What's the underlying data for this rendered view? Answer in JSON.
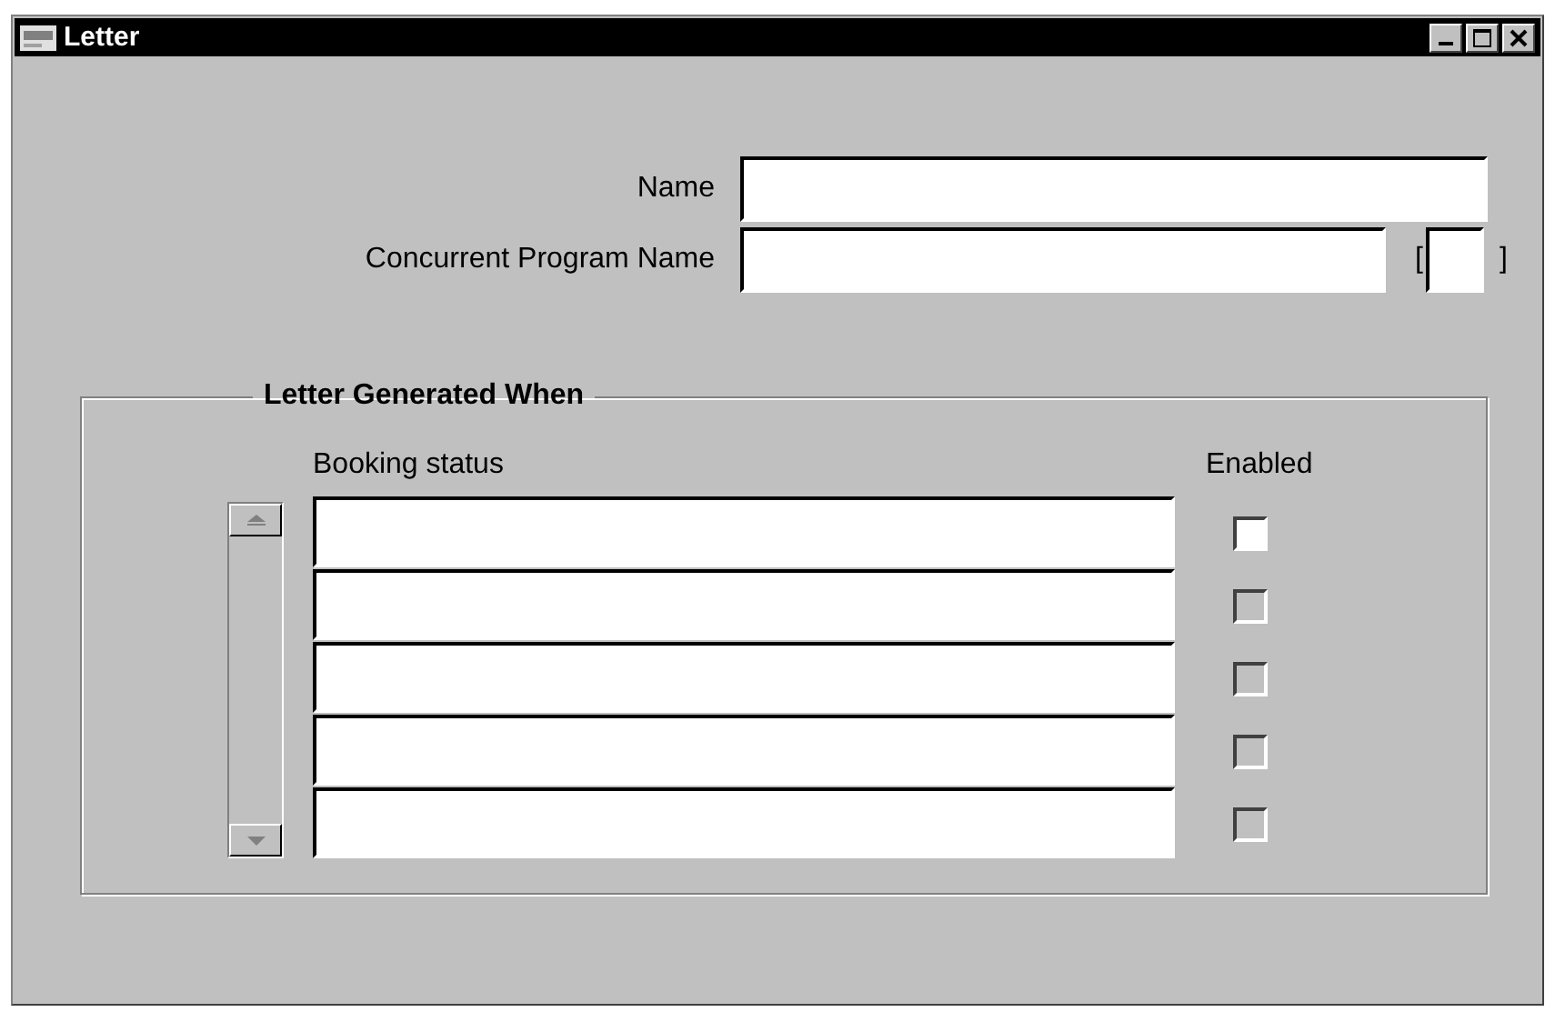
{
  "window": {
    "title": "Letter"
  },
  "fields": [
    {
      "label": "Name"
    },
    {
      "label": "Concurrent Program Name",
      "bracket_open": "[",
      "bracket_close": "]"
    }
  ],
  "group": {
    "title": "Letter Generated When",
    "columns": [
      "Booking status",
      "Enabled"
    ],
    "rows": [
      {
        "checked": false,
        "disabled": false
      },
      {
        "checked": false,
        "disabled": true
      },
      {
        "checked": false,
        "disabled": true
      },
      {
        "checked": false,
        "disabled": true
      },
      {
        "checked": false,
        "disabled": true
      }
    ]
  }
}
